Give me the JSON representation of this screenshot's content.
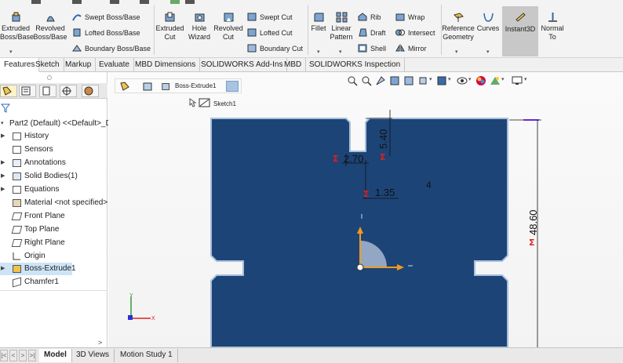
{
  "ribbon": {
    "extruded_boss": "Extruded Boss/Base",
    "revolved_boss": "Revolved Boss/Base",
    "swept_boss": "Swept Boss/Base",
    "lofted_boss": "Lofted Boss/Base",
    "boundary_boss": "Boundary Boss/Base",
    "extruded_cut": "Extruded Cut",
    "hole_wizard": "Hole Wizard",
    "revolved_cut": "Revolved Cut",
    "swept_cut": "Swept Cut",
    "lofted_cut": "Lofted Cut",
    "boundary_cut": "Boundary Cut",
    "fillet": "Fillet",
    "linear_pattern": "Linear Pattern",
    "rib": "Rib",
    "draft": "Draft",
    "shell": "Shell",
    "wrap": "Wrap",
    "intersect": "Intersect",
    "mirror": "Mirror",
    "reference_geometry": "Reference Geometry",
    "curves": "Curves",
    "instant3d": "Instant3D",
    "normal_to": "Normal To"
  },
  "tabs": [
    "Features",
    "Sketch",
    "Markup",
    "Evaluate",
    "MBD Dimensions",
    "SOLIDWORKS Add-Ins",
    "MBD",
    "SOLIDWORKS Inspection"
  ],
  "tree": {
    "root": "Part2 (Default) <<Default>_D",
    "items": [
      "History",
      "Sensors",
      "Annotations",
      "Solid Bodies(1)",
      "Equations",
      "Material <not specified>",
      "Front Plane",
      "Top Plane",
      "Right Plane",
      "Origin",
      "Boss-Extrude1",
      "Chamfer1"
    ]
  },
  "breadcrumb": {
    "feature": "Boss-Extrude1",
    "sketch": "Sketch1"
  },
  "dimensions": {
    "d1": "5.40",
    "d2": "2.70",
    "d3": "1.35",
    "d4": "4",
    "d5": "48.60"
  },
  "bottom_tabs": [
    "Model",
    "3D Views",
    "Motion Study 1"
  ],
  "colors": {
    "part": "#1d4477",
    "edge": "#a8c0dc",
    "dim_red": "#e0201e",
    "axis_orange": "#f39a1e",
    "axis_blue": "#2a2fd6"
  }
}
